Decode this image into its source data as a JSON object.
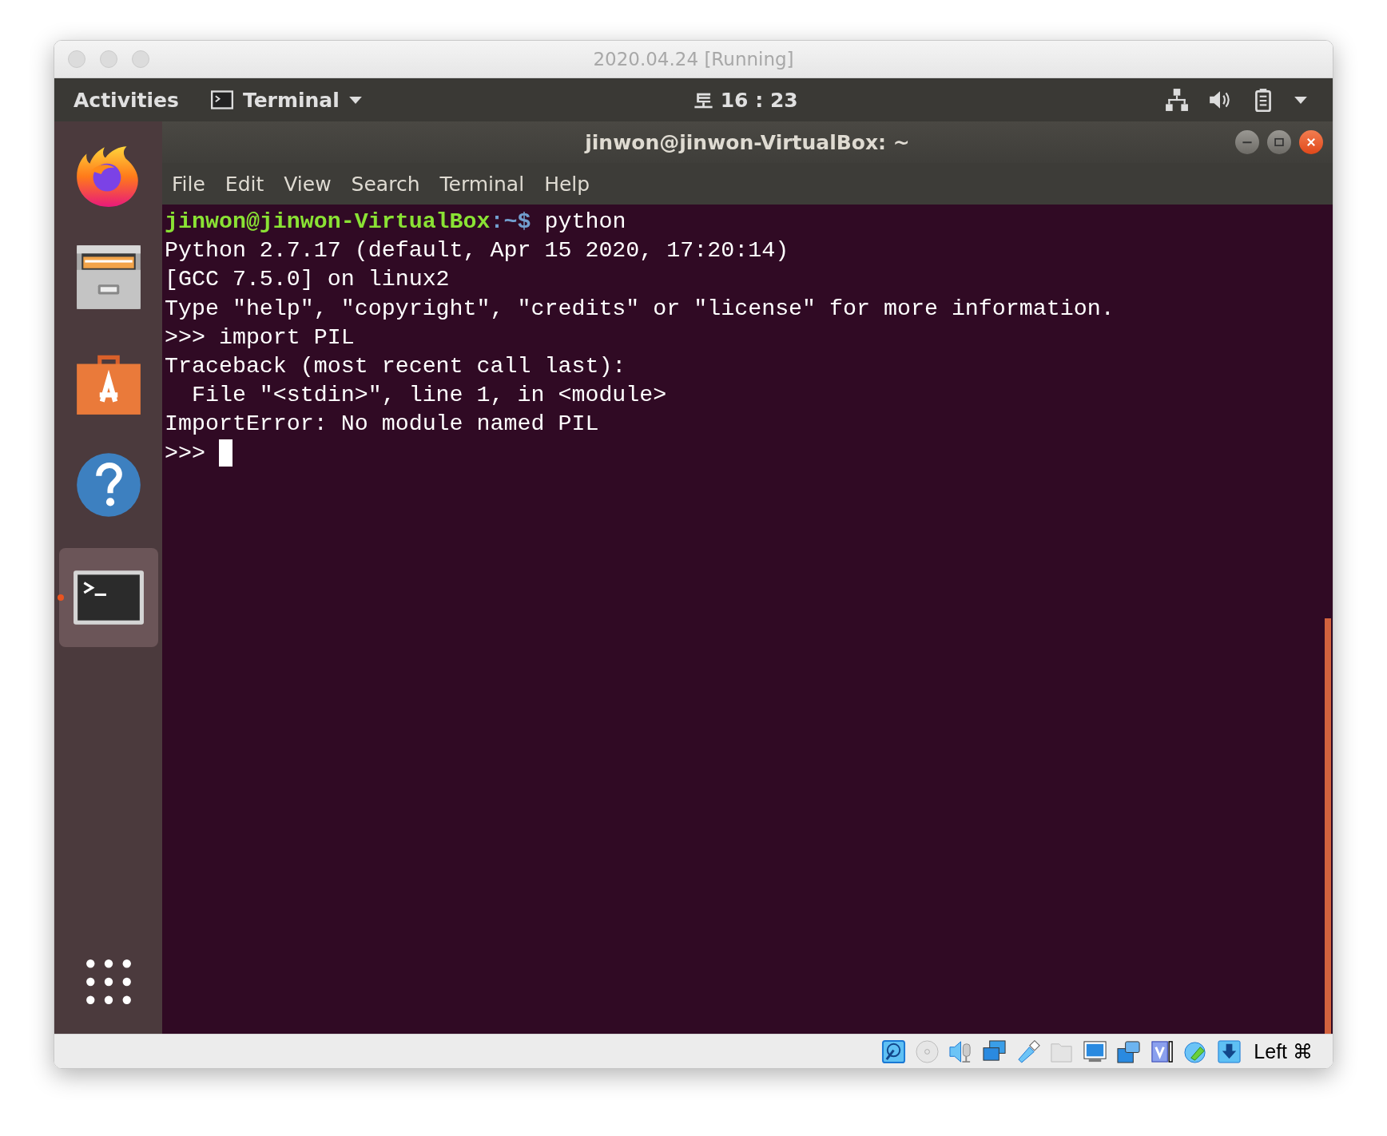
{
  "window": {
    "title": "2020.04.24 [Running]"
  },
  "top_bar": {
    "activities": "Activities",
    "app_menu": "Terminal",
    "clock": "토 16 : 23"
  },
  "dock": {
    "items": [
      {
        "kind": "firefox",
        "selected": false,
        "running": false
      },
      {
        "kind": "files",
        "selected": false,
        "running": false
      },
      {
        "kind": "software",
        "selected": false,
        "running": false
      },
      {
        "kind": "help",
        "selected": false,
        "running": false
      },
      {
        "kind": "terminal",
        "selected": true,
        "running": true
      }
    ]
  },
  "terminal": {
    "title": "jinwon@jinwon-VirtualBox: ~",
    "menu": [
      "File",
      "Edit",
      "View",
      "Search",
      "Terminal",
      "Help"
    ],
    "lines": [
      {
        "kind": "prompt",
        "user": "jinwon@jinwon-VirtualBox",
        "path": ":~$",
        "command": "python"
      },
      {
        "kind": "output",
        "text": "Python 2.7.17 (default, Apr 15 2020, 17:20:14)"
      },
      {
        "kind": "output",
        "text": "[GCC 7.5.0] on linux2"
      },
      {
        "kind": "output",
        "text": "Type \"help\", \"copyright\", \"credits\" or \"license\" for more information."
      },
      {
        "kind": "output",
        "text": ">>> import PIL"
      },
      {
        "kind": "output",
        "text": "Traceback (most recent call last):"
      },
      {
        "kind": "output",
        "text": "  File \"<stdin>\", line 1, in <module>"
      },
      {
        "kind": "output",
        "text": "ImportError: No module named PIL"
      },
      {
        "kind": "input",
        "text": ">>>",
        "cursor": true
      }
    ]
  },
  "status_bar": {
    "host_key": "Left ⌘"
  }
}
